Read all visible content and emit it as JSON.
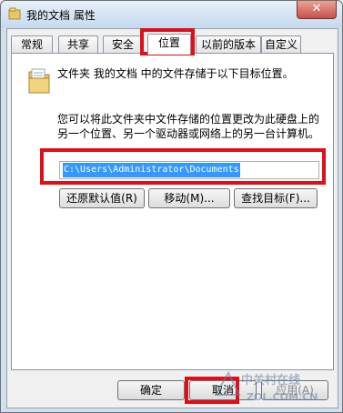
{
  "window": {
    "title": "我的文档 属性",
    "close_glyph": "✕"
  },
  "tabs": [
    "常规",
    "共享",
    "安全",
    "位置",
    "以前的版本",
    "自定义"
  ],
  "active_tab": "位置",
  "location": {
    "description": "文件夹 我的文档 中的文件存储于以下目标位置。",
    "info": "您可以将此文件夹中文件存储的位置更改为此硬盘上的另一个位置、另一个驱动器或网络上的另一台计算机。",
    "path_value": "C:\\Users\\Administrator\\Documents",
    "restore_button": "还原默认值(R)",
    "move_button": "移动(M)...",
    "find_button": "查找目标(F)..."
  },
  "footer": {
    "ok": "确定",
    "cancel": "取消",
    "apply": "应用(A)"
  },
  "watermark": {
    "text_cn": "中关村在线",
    "text_en": "ZOL.COM.CN"
  },
  "colors": {
    "highlight": "#e00e16",
    "selection": "#3399ff"
  }
}
